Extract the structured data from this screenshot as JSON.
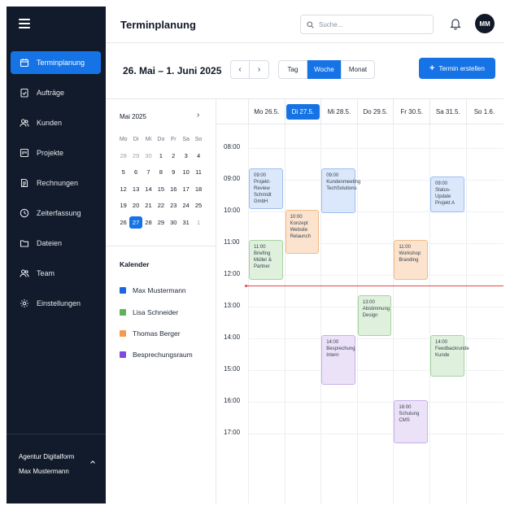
{
  "sidebar": {
    "items": [
      {
        "label": "Terminplanung",
        "icon": "calendar-icon",
        "active": true
      },
      {
        "label": "Aufträge",
        "icon": "clipboard-check-icon"
      },
      {
        "label": "Kunden",
        "icon": "users-icon"
      },
      {
        "label": "Projekte",
        "icon": "folder-kanban-icon"
      },
      {
        "label": "Rechnungen",
        "icon": "invoice-icon"
      },
      {
        "label": "Zeiterfassung",
        "icon": "clock-icon"
      },
      {
        "label": "Dateien",
        "icon": "folder-icon"
      },
      {
        "label": "Team",
        "icon": "team-icon"
      },
      {
        "label": "Einstellungen",
        "icon": "gear-icon"
      }
    ],
    "org": "Agentur Digitalform",
    "user": "Max Mustermann"
  },
  "header": {
    "title": "Terminplanung",
    "search_placeholder": "Suche...",
    "avatar_initials": "MM"
  },
  "toolbar": {
    "range": "26. Mai – 1. Juni 2025",
    "prev": "‹",
    "next": "›",
    "views": [
      "Tag",
      "Woche",
      "Monat"
    ],
    "active_view": "Woche",
    "create_label": "Termin erstellen"
  },
  "mini_calendar": {
    "title": "Mai 2025",
    "next": "›",
    "weekdays": [
      "Mo",
      "Di",
      "Mi",
      "Do",
      "Fr",
      "Sa",
      "So"
    ],
    "weeks": [
      [
        "28",
        "29",
        "30",
        "1",
        "2",
        "3",
        "4"
      ],
      [
        "5",
        "6",
        "7",
        "8",
        "9",
        "10",
        "11"
      ],
      [
        "12",
        "13",
        "14",
        "15",
        "16",
        "17",
        "18"
      ],
      [
        "19",
        "20",
        "21",
        "22",
        "23",
        "24",
        "25"
      ],
      [
        "26",
        "27",
        "28",
        "29",
        "30",
        "31",
        "1"
      ]
    ],
    "today": "27"
  },
  "calendars": {
    "title": "Kalender",
    "items": [
      {
        "name": "Max Mustermann",
        "color": "#1e66e0"
      },
      {
        "name": "Lisa Schneider",
        "color": "#5fb15a"
      },
      {
        "name": "Thomas Berger",
        "color": "#f39a4e"
      },
      {
        "name": "Besprechungsraum",
        "color": "#7c4ddb"
      }
    ]
  },
  "week": {
    "days": [
      "Mo 26.5.",
      "Di 27.5.",
      "Mi 28.5.",
      "Do 29.5.",
      "Fr 30.5.",
      "Sa 31.5.",
      "So 1.6."
    ],
    "today": "Di 27.5.",
    "times": [
      "08:00",
      "09:00",
      "10:00",
      "11:00",
      "12:00",
      "13:00",
      "14:00",
      "15:00",
      "16:00",
      "17:00"
    ],
    "events": [
      {
        "day": "Mo 26.5.",
        "time": "09:00",
        "title": "Projekt-Review Schmidt GmbH",
        "color": "blue"
      },
      {
        "day": "Di 27.5.",
        "time": "10:00",
        "title": "Konzept Website Relaunch",
        "color": "orange"
      },
      {
        "day": "Mi 28.5.",
        "time": "09:00",
        "title": "Kundenmeeting TechSolutions",
        "color": "blue"
      },
      {
        "day": "Mo 26.5.",
        "time": "11:00",
        "title": "Briefing Müller & Partner",
        "color": "green"
      },
      {
        "day": "Fr 30.5.",
        "time": "11:00",
        "title": "Workshop Branding",
        "color": "orange"
      },
      {
        "day": "Sa 31.5.",
        "time": "09:00",
        "title": "Status-Update Projekt A",
        "color": "blue"
      },
      {
        "day": "Do 29.5.",
        "time": "13:00",
        "title": "Abstimmung Design",
        "color": "green"
      },
      {
        "day": "Mi 28.5.",
        "time": "14:00",
        "title": "Besprechung Intern",
        "color": "purple"
      },
      {
        "day": "Sa 31.5.",
        "time": "14:00",
        "title": "Feedbackrunde Kunde",
        "color": "green"
      },
      {
        "day": "Fr 30.5.",
        "time": "16:00",
        "title": "Schulung CMS",
        "color": "purple"
      }
    ]
  }
}
